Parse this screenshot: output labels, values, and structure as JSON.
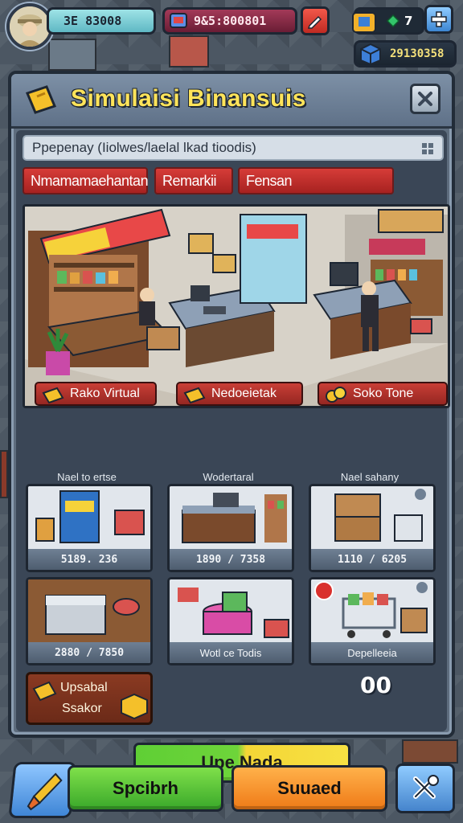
{
  "hud": {
    "xp_value": "3E 83008",
    "money_value": "9&5:800801",
    "gems_count": "7",
    "crates_value": "29130358"
  },
  "panel": {
    "title": "Simulaisi Binansuis",
    "search_text": "Ppepenay (Iiolwes/laelal lkad tioodis)",
    "chips": [
      "Nmamamaehantan",
      "Remarkii",
      "Fensan"
    ],
    "shop_tabs": [
      "Rako Virtual",
      "Nedoeietak",
      "Soko Tone"
    ],
    "columns": [
      "Nael to ertse",
      "Wodertaral",
      "Nael sahany"
    ],
    "cards": [
      {
        "label": "5189. 236"
      },
      {
        "label": "1890 / 7358"
      },
      {
        "label": "1110 / 6205"
      },
      {
        "label": "2880 / 7850"
      },
      {
        "label": "Wotl ce Todis"
      },
      {
        "label": "Depelleeia"
      }
    ],
    "upgrade": {
      "line1": "Upsabal",
      "line2": "Ssakor"
    },
    "counter": "00",
    "cta": "Upe Nada"
  },
  "bottom": {
    "green_label": "Spcibrh",
    "orange_label": "Suuaed"
  },
  "colors": {
    "accent_yellow": "#ffe45a",
    "chip_red": "#d63c38",
    "panel": "#5e6d7e",
    "green": "#5fcf35",
    "orange": "#ef7a17",
    "blue": "#4584cc"
  }
}
